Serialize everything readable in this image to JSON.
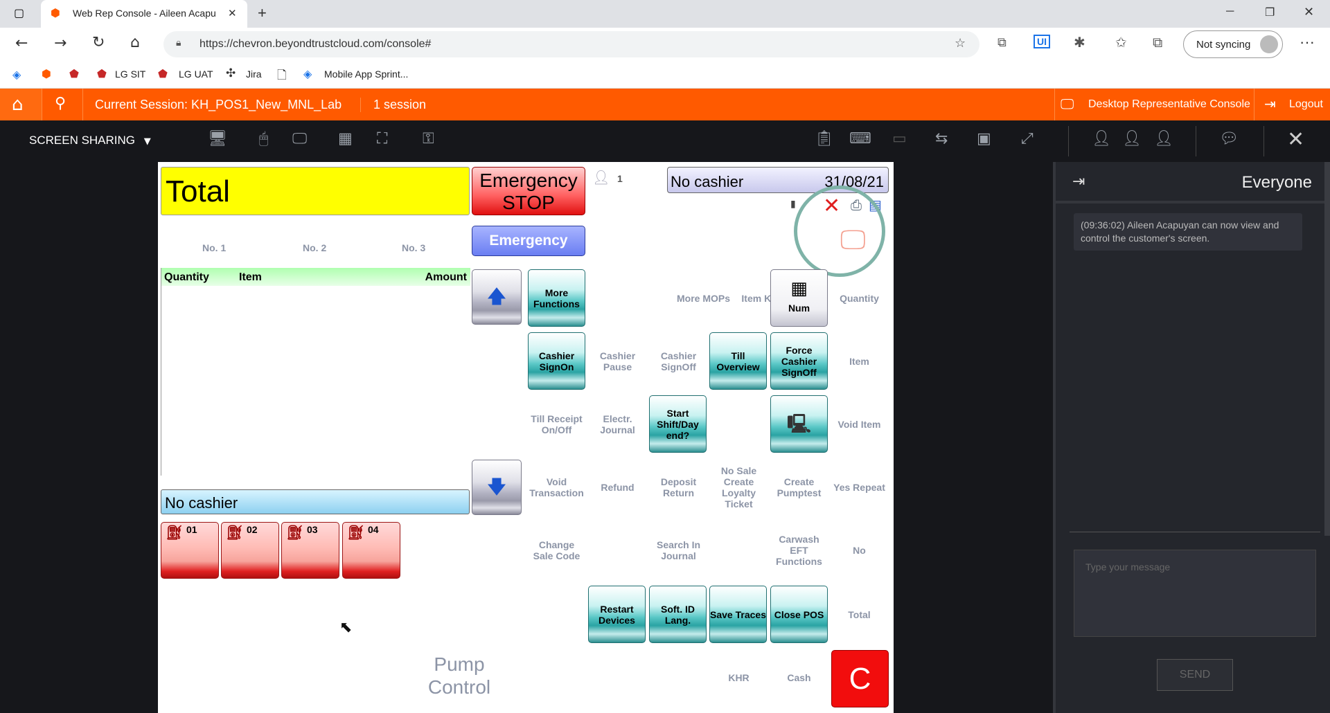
{
  "browser": {
    "tab_title": "Web Rep Console - Aileen Acapu",
    "url": "https://chevron.beyondtrustcloud.com/console#",
    "sync_label": "Not syncing",
    "bookmarks": [
      "LG SIT",
      "LG UAT",
      "Jira",
      "Mobile App Sprint..."
    ]
  },
  "header": {
    "session": "Current Session: KH_POS1_New_MNL_Lab",
    "session_count": "1 session",
    "console_label": "Desktop Representative Console",
    "logout": "Logout"
  },
  "toolbar": {
    "screen_sharing": "SCREEN SHARING"
  },
  "chat": {
    "title": "Everyone",
    "message": "(09:36:02) Aileen Acapuyan can now view and control the customer's screen.",
    "placeholder": "Type your message",
    "send": "SEND"
  },
  "pos": {
    "total": "Total",
    "emergency_stop_1": "Emergency",
    "emergency_stop_2": "STOP",
    "emergency": "Emergency",
    "cashier_count": "1",
    "status": "No cashier",
    "date": "31/08/21",
    "no1": "No. 1",
    "no2": "No. 2",
    "no3": "No. 3",
    "col_quantity": "Quantity",
    "col_item": "Item",
    "col_amount": "Amount",
    "no_cashier_bar": "No cashier",
    "pumps": [
      "01",
      "02",
      "03",
      "04"
    ],
    "pump_control": "Pump Control",
    "cancel": "C",
    "num": "Num",
    "buttons": {
      "more_functions": "More Functions",
      "cashier_signon": "Cashier SignOn",
      "till_overview": "Till Overview",
      "force_cashier_signoff": "Force Cashier SignOff",
      "start_shift": "Start Shift/Day end?",
      "restart_devices": "Restart Devices",
      "soft_id": "Soft. ID Lang.",
      "save_traces": "Save Traces",
      "close_pos": "Close POS"
    },
    "labels": {
      "more_mops": "More MOPs",
      "item_keys": "Item Keys",
      "quantity": "Quantity",
      "cashier_pause": "Cashier Pause",
      "cashier_signoff": "Cashier SignOff",
      "item": "Item",
      "till_receipt": "Till Receipt On/Off",
      "electr_journal": "Electr. Journal",
      "void_item": "Void Item",
      "void_transaction": "Void Transaction",
      "refund": "Refund",
      "deposit_return": "Deposit Return",
      "no_sale": "No Sale Create Loyalty Ticket",
      "create_pumptest": "Create Pumptest",
      "yes_repeat": "Yes Repeat",
      "change_sale_code": "Change Sale Code",
      "search_journal": "Search In Journal",
      "carwash": "Carwash EFT Functions",
      "no": "No",
      "total": "Total",
      "khr": "KHR",
      "cash": "Cash"
    }
  }
}
